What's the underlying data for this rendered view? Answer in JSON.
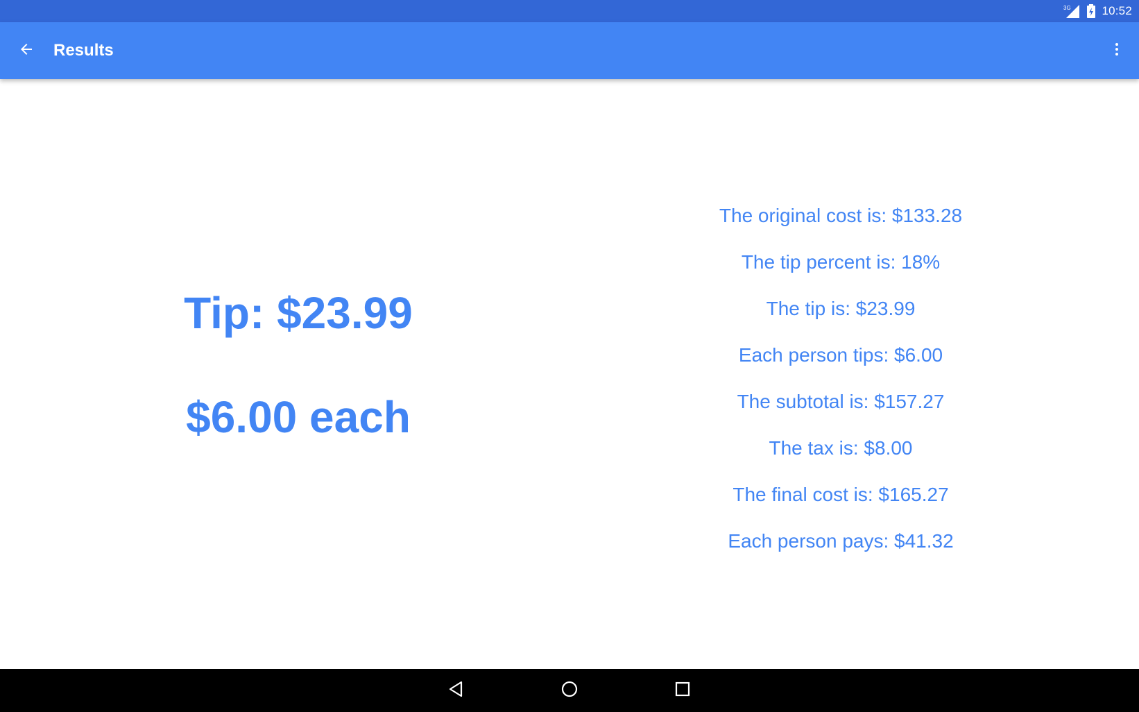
{
  "status_bar": {
    "network_label": "3G",
    "time": "10:52",
    "signal_icon": "signal-icon",
    "battery_icon": "battery-charging-icon"
  },
  "app_bar": {
    "title": "Results",
    "back_icon": "arrow-back-icon",
    "overflow_icon": "more-vert-icon"
  },
  "summary": {
    "tip_line": "Tip: $23.99",
    "each_line": "$6.00 each"
  },
  "details": [
    "The original cost is: $133.28",
    "The tip percent is: 18%",
    "The tip is: $23.99",
    "Each person tips: $6.00",
    "The subtotal is: $157.27",
    "The tax is: $8.00",
    "The final cost is: $165.27",
    "Each person pays: $41.32"
  ],
  "nav_bar": {
    "back_icon": "nav-back-icon",
    "home_icon": "nav-home-icon",
    "recents_icon": "nav-recents-icon"
  },
  "colors": {
    "status_bar": "#3367d6",
    "app_bar": "#4285f4",
    "accent_text": "#4285f4",
    "nav_bar": "#000000"
  }
}
